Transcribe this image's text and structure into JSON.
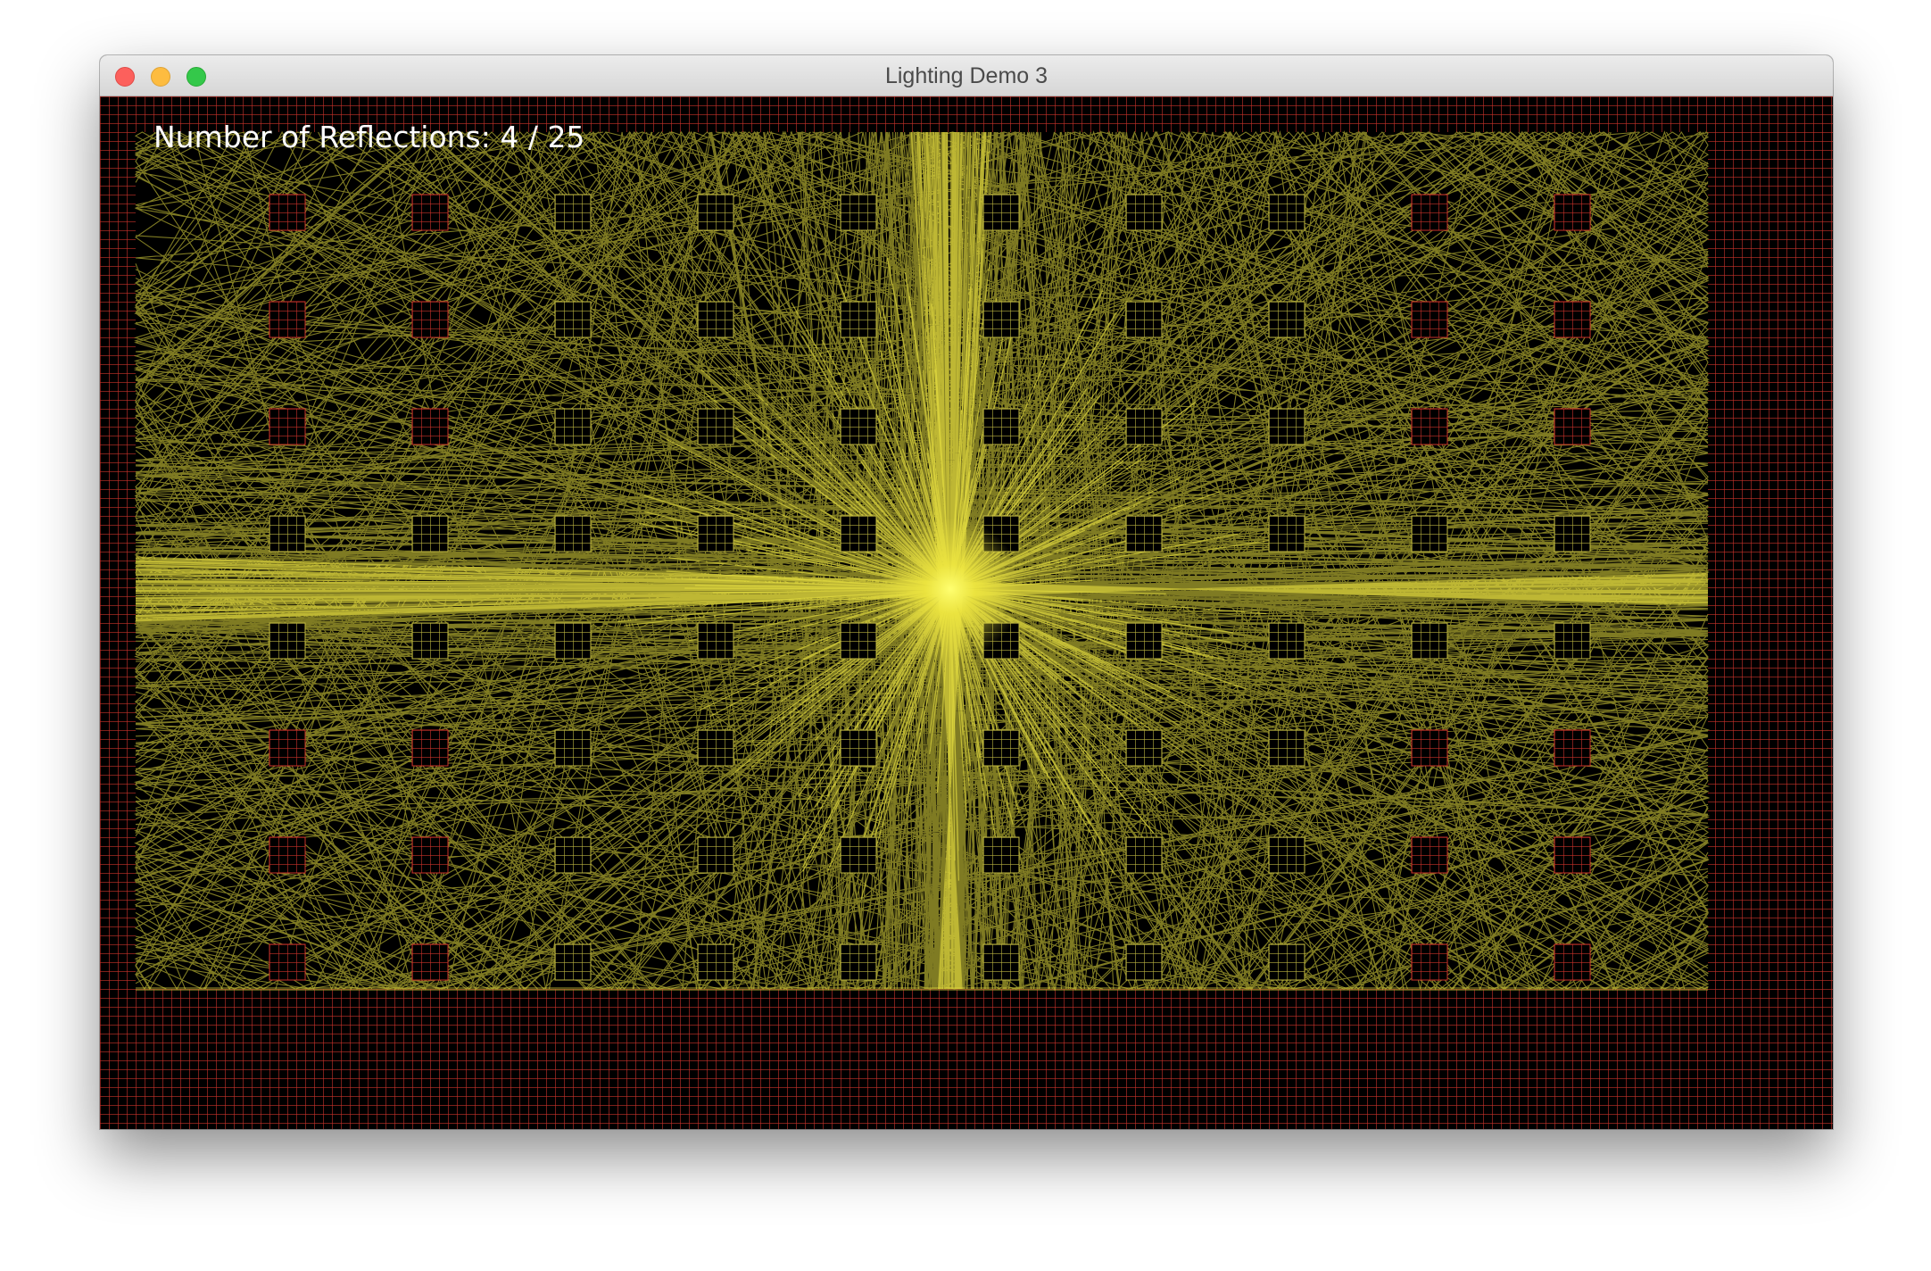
{
  "window": {
    "title": "Lighting Demo 3"
  },
  "hud": {
    "reflections_label": "Number of Reflections:",
    "current_reflections": 4,
    "max_reflections": 25,
    "text": "Number of Reflections: 4 / 25"
  },
  "colors": {
    "wall_grid": "#c8322a",
    "light_ray": "#e8e040",
    "background": "#000000"
  }
}
